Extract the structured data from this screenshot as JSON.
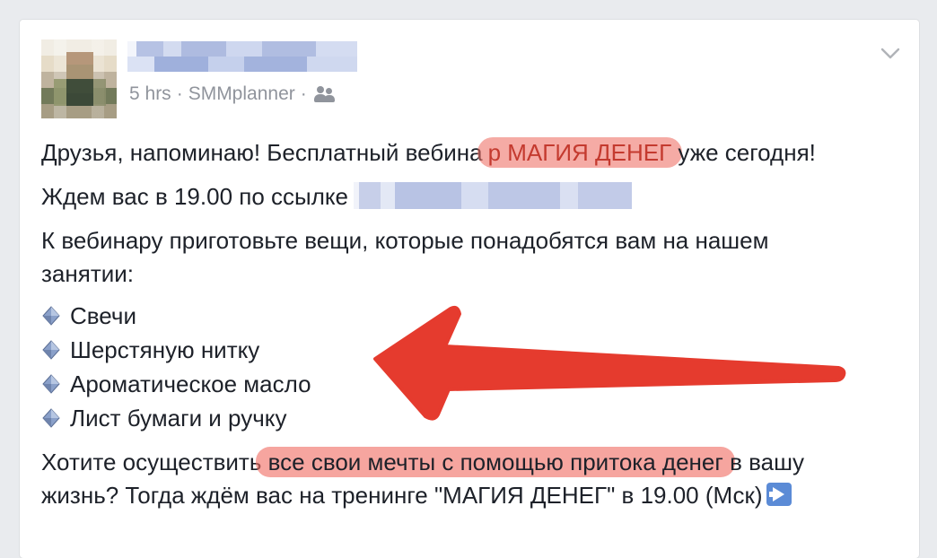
{
  "post": {
    "meta": {
      "time": "5 hrs",
      "separator": "·",
      "source": "SMMplanner",
      "audience_icon": "friends-icon"
    },
    "line1": {
      "before": "Друзья, напоминаю! Бесплатный вебина",
      "highlight_prefix": "р ",
      "highlight": "МАГИЯ ДЕНЕГ",
      "after": " уже сегодня!"
    },
    "line2": "Ждем вас в 19.00 по ссылке",
    "line3": "К вебинару приготовьте вещи, которые понадобятся вам на нашем",
    "line4": "занятии:",
    "bullets": [
      "Свечи",
      "Шерстяную нитку",
      "Ароматическое масло",
      "Лист бумаги и ручку"
    ],
    "line5": {
      "before": "Хотите осуществить",
      "highlight": " все свои мечты с помощью притока денег ",
      "after": "в вашу"
    },
    "line6": "жизнь? Тогда ждём вас на тренинге \"МАГИЯ ДЕНЕГ\" в 19.00 (Мск)",
    "line6_emoji": "arrow-right-emoji"
  },
  "colors": {
    "highlight": "#f06e64",
    "highlight_text": "#c43a2f",
    "arrow": "#e53b2e",
    "meta_text": "#90949c",
    "body_text": "#1d2129"
  }
}
